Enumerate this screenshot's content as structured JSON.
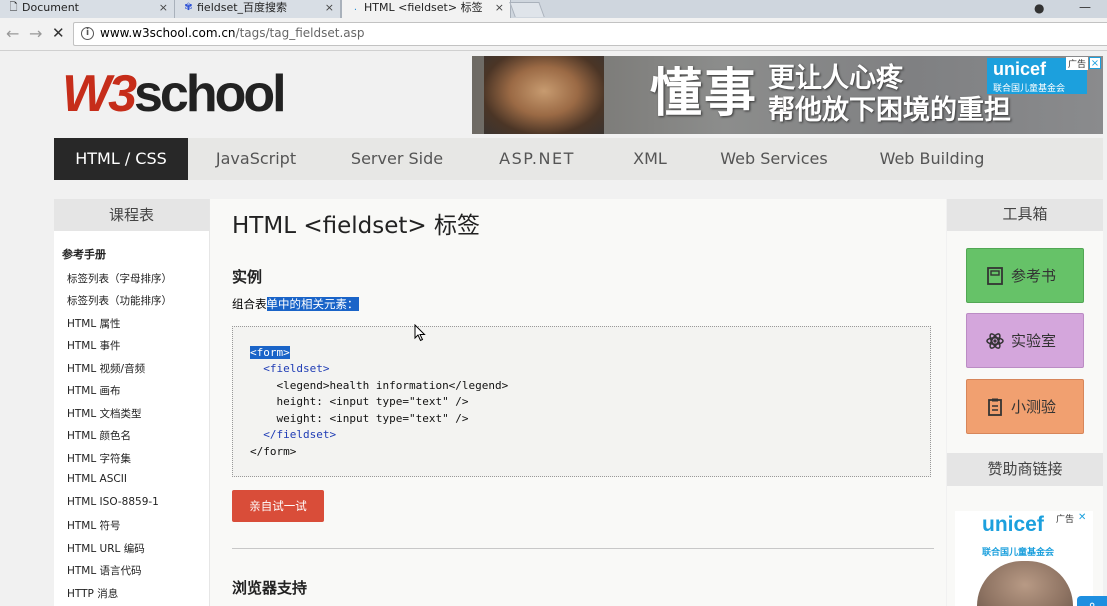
{
  "browser": {
    "tabs": [
      {
        "title": "Document"
      },
      {
        "title": "fieldset_百度搜索"
      },
      {
        "title": "HTML <fieldset> 标签"
      }
    ],
    "url_host": "www.w3school.com.cn",
    "url_path": "/tags/tag_fieldset.asp"
  },
  "site": {
    "logo_w3": "W3",
    "logo_school": "school"
  },
  "banner": {
    "big_text": "懂事",
    "line1": "更让人心疼",
    "line2": "帮他放下困境的重担",
    "brand": "unicef",
    "brand_sub": "联合国儿童基金会",
    "ad_label": "广告"
  },
  "nav": {
    "items": [
      "HTML / CSS",
      "JavaScript",
      "Server Side",
      "ASP.NET",
      "XML",
      "Web Services",
      "Web Building"
    ]
  },
  "left_sidebar": {
    "heading": "课程表",
    "section": "参考手册",
    "links": [
      "标签列表（字母排序）",
      "标签列表（功能排序）",
      "HTML 属性",
      "HTML 事件",
      "HTML 视频/音频",
      "HTML 画布",
      "HTML 文档类型",
      "HTML 颜色名",
      "HTML 字符集",
      "HTML ASCII",
      "HTML ISO-8859-1",
      "HTML 符号",
      "HTML URL 编码",
      "HTML 语言代码",
      "HTTP 消息"
    ]
  },
  "main": {
    "title": "HTML <fieldset> 标签",
    "example_heading": "实例",
    "desc_plain": "组合表",
    "desc_selected": "单中的相关元素：",
    "code": {
      "l1": "<form>",
      "l2": "<fieldset>",
      "l3": "<legend>health information</legend>",
      "l4": "height: <input type=\"text\" />",
      "l5": "weight: <input type=\"text\" />",
      "l6": "</fieldset>",
      "l7": "</form>"
    },
    "try_button": "亲自试一试",
    "browser_support_heading": "浏览器支持"
  },
  "right_sidebar": {
    "heading": "工具箱",
    "tools": [
      "参考书",
      "实验室",
      "小测验"
    ],
    "sponsor_heading": "赞助商链接",
    "ad_brand": "unicef",
    "ad_brand_sub": "联合国儿童基金会",
    "ad_label": "广告"
  }
}
